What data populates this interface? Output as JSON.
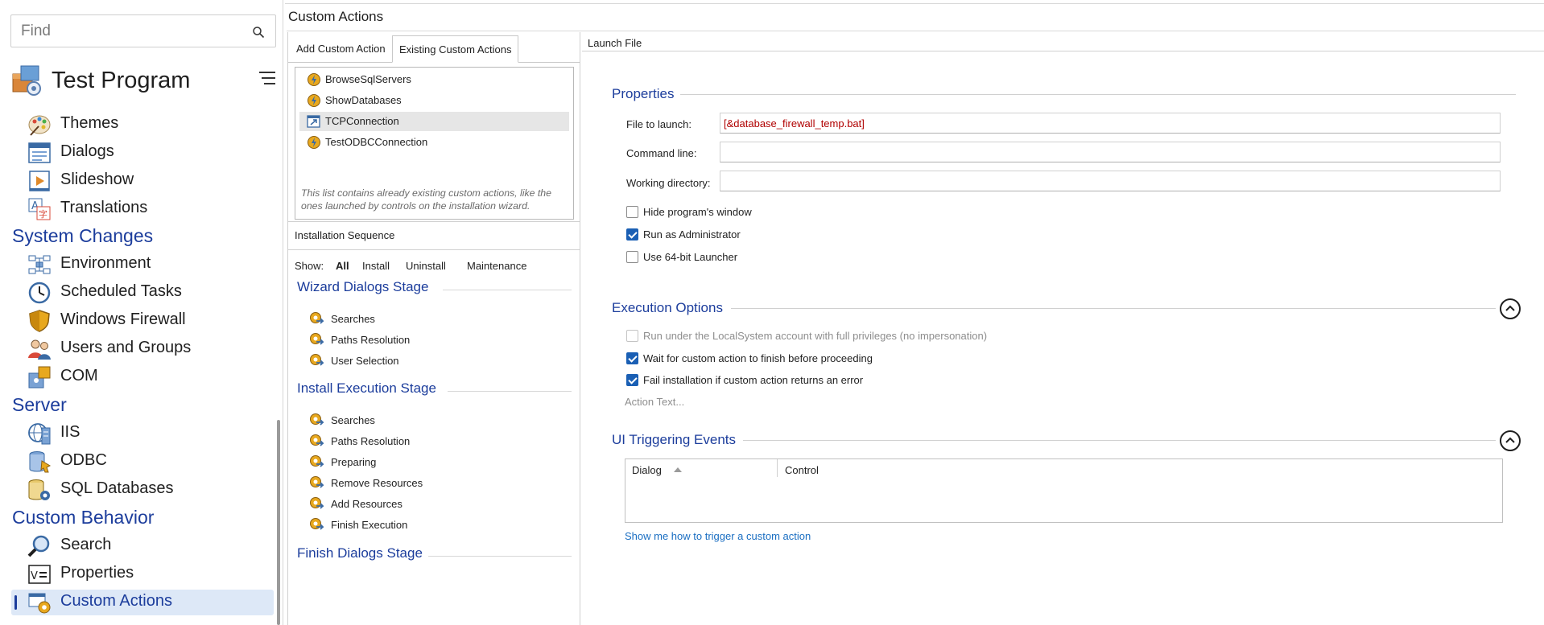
{
  "search": {
    "placeholder": "Find",
    "value": ""
  },
  "project": {
    "title": "Test Program"
  },
  "nav": {
    "items_top": [
      {
        "label": "Themes",
        "icon": "palette-icon"
      },
      {
        "label": "Dialogs",
        "icon": "dialog-window-icon"
      },
      {
        "label": "Slideshow",
        "icon": "slideshow-icon"
      },
      {
        "label": "Translations",
        "icon": "translate-icon"
      }
    ],
    "section_system": "System Changes",
    "items_system": [
      {
        "label": "Environment",
        "icon": "environment-icon"
      },
      {
        "label": "Scheduled Tasks",
        "icon": "clock-icon"
      },
      {
        "label": "Windows Firewall",
        "icon": "shield-icon"
      },
      {
        "label": "Users and Groups",
        "icon": "users-icon"
      },
      {
        "label": "COM",
        "icon": "com-puzzle-icon"
      }
    ],
    "section_server": "Server",
    "items_server": [
      {
        "label": "IIS",
        "icon": "globe-server-icon"
      },
      {
        "label": "ODBC",
        "icon": "database-plug-icon"
      },
      {
        "label": "SQL Databases",
        "icon": "database-gear-icon"
      }
    ],
    "section_custom": "Custom Behavior",
    "items_custom": [
      {
        "label": "Search",
        "icon": "magnifier-icon"
      },
      {
        "label": "Properties",
        "icon": "variable-icon"
      },
      {
        "label": "Custom Actions",
        "icon": "custom-actions-gear-icon",
        "selected": true
      }
    ]
  },
  "page": {
    "title": "Custom Actions"
  },
  "mid": {
    "tabs": [
      {
        "label": "Add Custom Action",
        "active": false
      },
      {
        "label": "Existing Custom Actions",
        "active": true
      }
    ],
    "custom_actions": [
      {
        "label": "BrowseSqlServers",
        "selected": false
      },
      {
        "label": "ShowDatabases",
        "selected": false
      },
      {
        "label": "TCPConnection",
        "selected": true
      },
      {
        "label": "TestODBCConnection",
        "selected": false
      }
    ],
    "note": "This list contains already existing custom actions, like the ones launched by controls on the installation wizard.",
    "sequence_title": "Installation Sequence",
    "show_label": "Show:",
    "show_filters": [
      "All",
      "Install",
      "Uninstall",
      "Maintenance"
    ],
    "stages": [
      {
        "title": "Wizard Dialogs Stage",
        "steps": [
          "Searches",
          "Paths Resolution",
          "User Selection"
        ]
      },
      {
        "title": "Install Execution Stage",
        "steps": [
          "Searches",
          "Paths Resolution",
          "Preparing",
          "Remove Resources",
          "Add Resources",
          "Finish Execution"
        ]
      },
      {
        "title": "Finish Dialogs Stage",
        "steps": []
      }
    ]
  },
  "detail": {
    "header": "Launch File",
    "properties_title": "Properties",
    "file_label": "File to launch:",
    "file_value": "[&database_firewall_temp.bat]",
    "command_label": "Command line:",
    "command_value": "",
    "workdir_label": "Working directory:",
    "workdir_value": "",
    "options": [
      {
        "label": "Hide program's window",
        "checked": false
      },
      {
        "label": "Run as Administrator",
        "checked": true
      },
      {
        "label": "Use 64-bit Launcher",
        "checked": false
      }
    ],
    "execution_title": "Execution Options",
    "execution_options": [
      {
        "label": "Run under the LocalSystem account with full privileges (no impersonation)",
        "checked": false,
        "disabled": true
      },
      {
        "label": "Wait for custom action to finish before proceeding",
        "checked": true,
        "disabled": false
      },
      {
        "label": "Fail installation if custom action returns an error",
        "checked": true,
        "disabled": false
      }
    ],
    "action_text": "Action Text...",
    "ui_events_title": "UI Triggering Events",
    "table_headers": [
      "Dialog",
      "Control"
    ],
    "help_link": "Show me how to trigger a custom action"
  },
  "colors": {
    "accent": "#1c3d9c",
    "link": "#1a6ec2",
    "check": "#1a5fb4",
    "value_red": "#b00000"
  }
}
